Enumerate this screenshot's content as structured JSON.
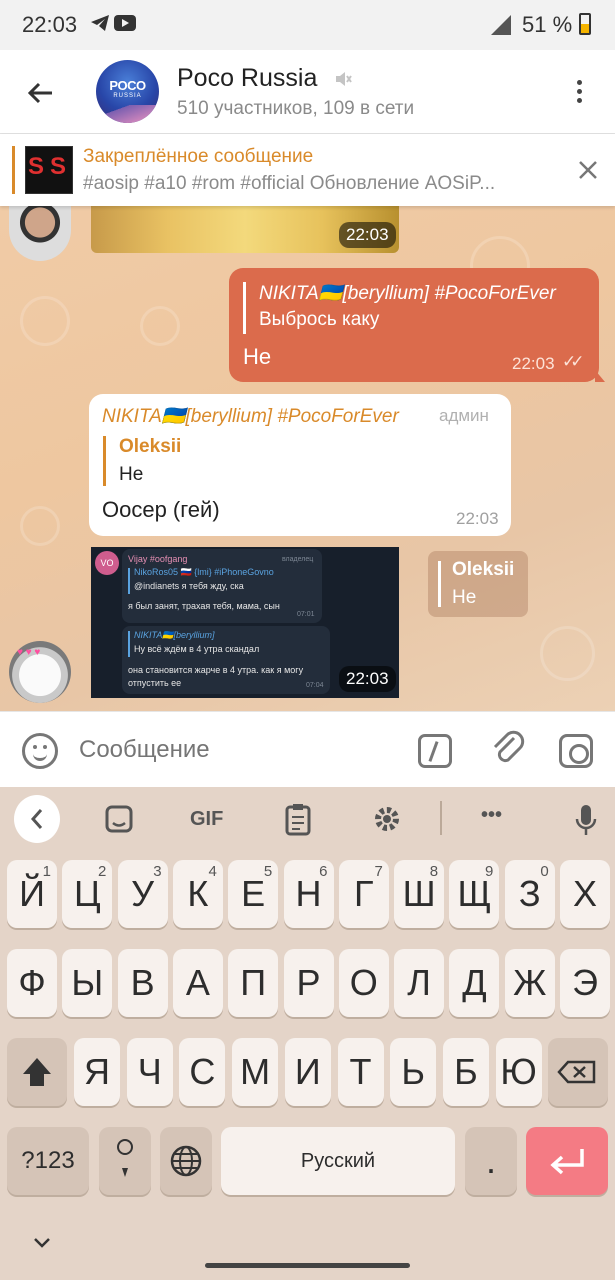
{
  "status_bar": {
    "time": "22:03",
    "battery": "51 %"
  },
  "header": {
    "avatar_line1": "POCO",
    "avatar_line2": "RUSSIA",
    "title": "Poco Russia",
    "subtitle": "510 участников, 109 в сети"
  },
  "pinned": {
    "label": "Закреплённое сообщение",
    "text": "#aosip #a10 #rom #official  Обновление AOSiP..."
  },
  "messages": {
    "m1": {
      "time": "22:03"
    },
    "m2": {
      "reply_author": "NIKITA🇺🇦[beryllium] #PocoForEver",
      "reply_text": "Выбрось каку",
      "text": "Не",
      "time": "22:03",
      "status": "✓✓"
    },
    "m3": {
      "author": "NIKITA🇺🇦[beryllium] #PocoForEver",
      "badge": "админ",
      "reply_author": "Oleksii",
      "reply_text": "Не",
      "text": "Оосер (гей)",
      "time": "22:03"
    },
    "m4": {
      "time": "22:03",
      "reply_author": "Oleksii",
      "reply_text": "Не",
      "shot": {
        "avatar": "VO",
        "author": "Vijay #oofgang",
        "role": "владелец",
        "quote_author": "NikoRos05 🇷🇺 {lmi} #iPhoneGovno",
        "quote_text": "@indianets я тебя жду, ска",
        "text": "я был занят, трахая тебя, мама, сын",
        "time1": "07:01",
        "quote2_author": "NIKITA🇺🇦[beryllium]",
        "quote2_text": "Ну всё ждём в 4 утра скандал",
        "text2": "она становится жарче в 4 утра.  как я могу отпустить ее",
        "time2": "07:04"
      }
    }
  },
  "composer": {
    "placeholder": "Сообщение"
  },
  "keyboard": {
    "toolbar": {
      "gif": "GIF",
      "more": "•••"
    },
    "row1": [
      {
        "k": "Й",
        "h": "1"
      },
      {
        "k": "Ц",
        "h": "2"
      },
      {
        "k": "У",
        "h": "3"
      },
      {
        "k": "К",
        "h": "4"
      },
      {
        "k": "Е",
        "h": "5"
      },
      {
        "k": "Н",
        "h": "6"
      },
      {
        "k": "Г",
        "h": "7"
      },
      {
        "k": "Ш",
        "h": "8"
      },
      {
        "k": "Щ",
        "h": "9"
      },
      {
        "k": "З",
        "h": "0"
      },
      {
        "k": "Х",
        "h": ""
      }
    ],
    "row2": [
      "Ф",
      "Ы",
      "В",
      "А",
      "П",
      "Р",
      "О",
      "Л",
      "Д",
      "Ж",
      "Э"
    ],
    "row3": [
      "Я",
      "Ч",
      "С",
      "М",
      "И",
      "Т",
      "Ь",
      "Б",
      "Ю"
    ],
    "symbols": "?123",
    "space": "Русский",
    "period": "."
  }
}
